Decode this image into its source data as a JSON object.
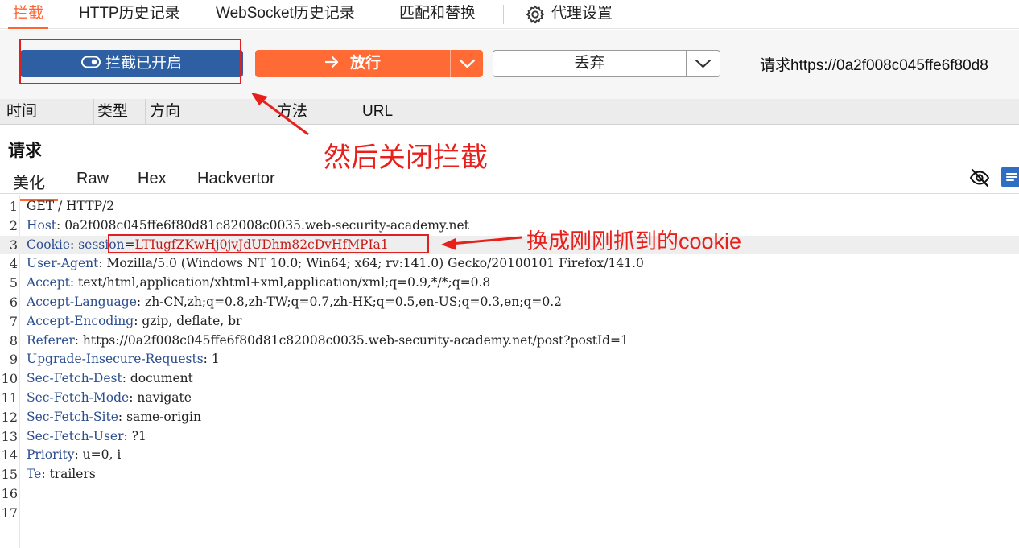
{
  "tabs": {
    "intercept": "拦截",
    "http_history": "HTTP历史记录",
    "websocket_history": "WebSocket历史记录",
    "match_replace": "匹配和替换",
    "proxy_settings": "代理设置"
  },
  "toolbar": {
    "intercept_toggle": "拦截已开启",
    "forward": "放行",
    "drop": "丢弃",
    "request_url": "请求https://0a2f008c045ffe6f80d8"
  },
  "history_columns": [
    "时间",
    "类型",
    "方向",
    "方法",
    "URL"
  ],
  "request_pane": {
    "title": "请求",
    "view_tabs": [
      "美化",
      "Raw",
      "Hex",
      "Hackvertor"
    ]
  },
  "request_lines": [
    {
      "num": "1",
      "key": "",
      "value": "GET / HTTP/2"
    },
    {
      "num": "2",
      "key": "Host",
      "value": " 0a2f008c045ffe6f80d81c82008c0035.web-security-academy.net"
    },
    {
      "num": "3",
      "key": "Cookie",
      "value": " ",
      "cookie_name": "session",
      "cookie_value": "LTIugfZKwHj0jvJdUDhm82cDvHfMPIa1"
    },
    {
      "num": "4",
      "key": "User-Agent",
      "value": " Mozilla/5.0 (Windows NT 10.0; Win64; x64; rv:141.0) Gecko/20100101 Firefox/141.0"
    },
    {
      "num": "5",
      "key": "Accept",
      "value": " text/html,application/xhtml+xml,application/xml;q=0.9,*/*;q=0.8"
    },
    {
      "num": "6",
      "key": "Accept-Language",
      "value": " zh-CN,zh;q=0.8,zh-TW;q=0.7,zh-HK;q=0.5,en-US;q=0.3,en;q=0.2"
    },
    {
      "num": "7",
      "key": "Accept-Encoding",
      "value": " gzip, deflate, br"
    },
    {
      "num": "8",
      "key": "Referer",
      "value": " https://0a2f008c045ffe6f80d81c82008c0035.web-security-academy.net/post?postId=1"
    },
    {
      "num": "9",
      "key": "Upgrade-Insecure-Requests",
      "value": " 1"
    },
    {
      "num": "10",
      "key": "Sec-Fetch-Dest",
      "value": " document"
    },
    {
      "num": "11",
      "key": "Sec-Fetch-Mode",
      "value": " navigate"
    },
    {
      "num": "12",
      "key": "Sec-Fetch-Site",
      "value": " same-origin"
    },
    {
      "num": "13",
      "key": "Sec-Fetch-User",
      "value": " ?1"
    },
    {
      "num": "14",
      "key": "Priority",
      "value": " u=0, i"
    },
    {
      "num": "15",
      "key": "Te",
      "value": " trailers"
    },
    {
      "num": "16",
      "key": "",
      "value": ""
    },
    {
      "num": "17",
      "key": "",
      "value": ""
    }
  ],
  "annotations": {
    "close_intercept": "然后关闭拦截",
    "replace_cookie": "换成刚刚抓到的cookie"
  },
  "colors": {
    "accent": "#ff6633",
    "intercept_button": "#2e5fa3",
    "forward_button": "#ff6a35",
    "annotation_red": "#e8201b"
  }
}
